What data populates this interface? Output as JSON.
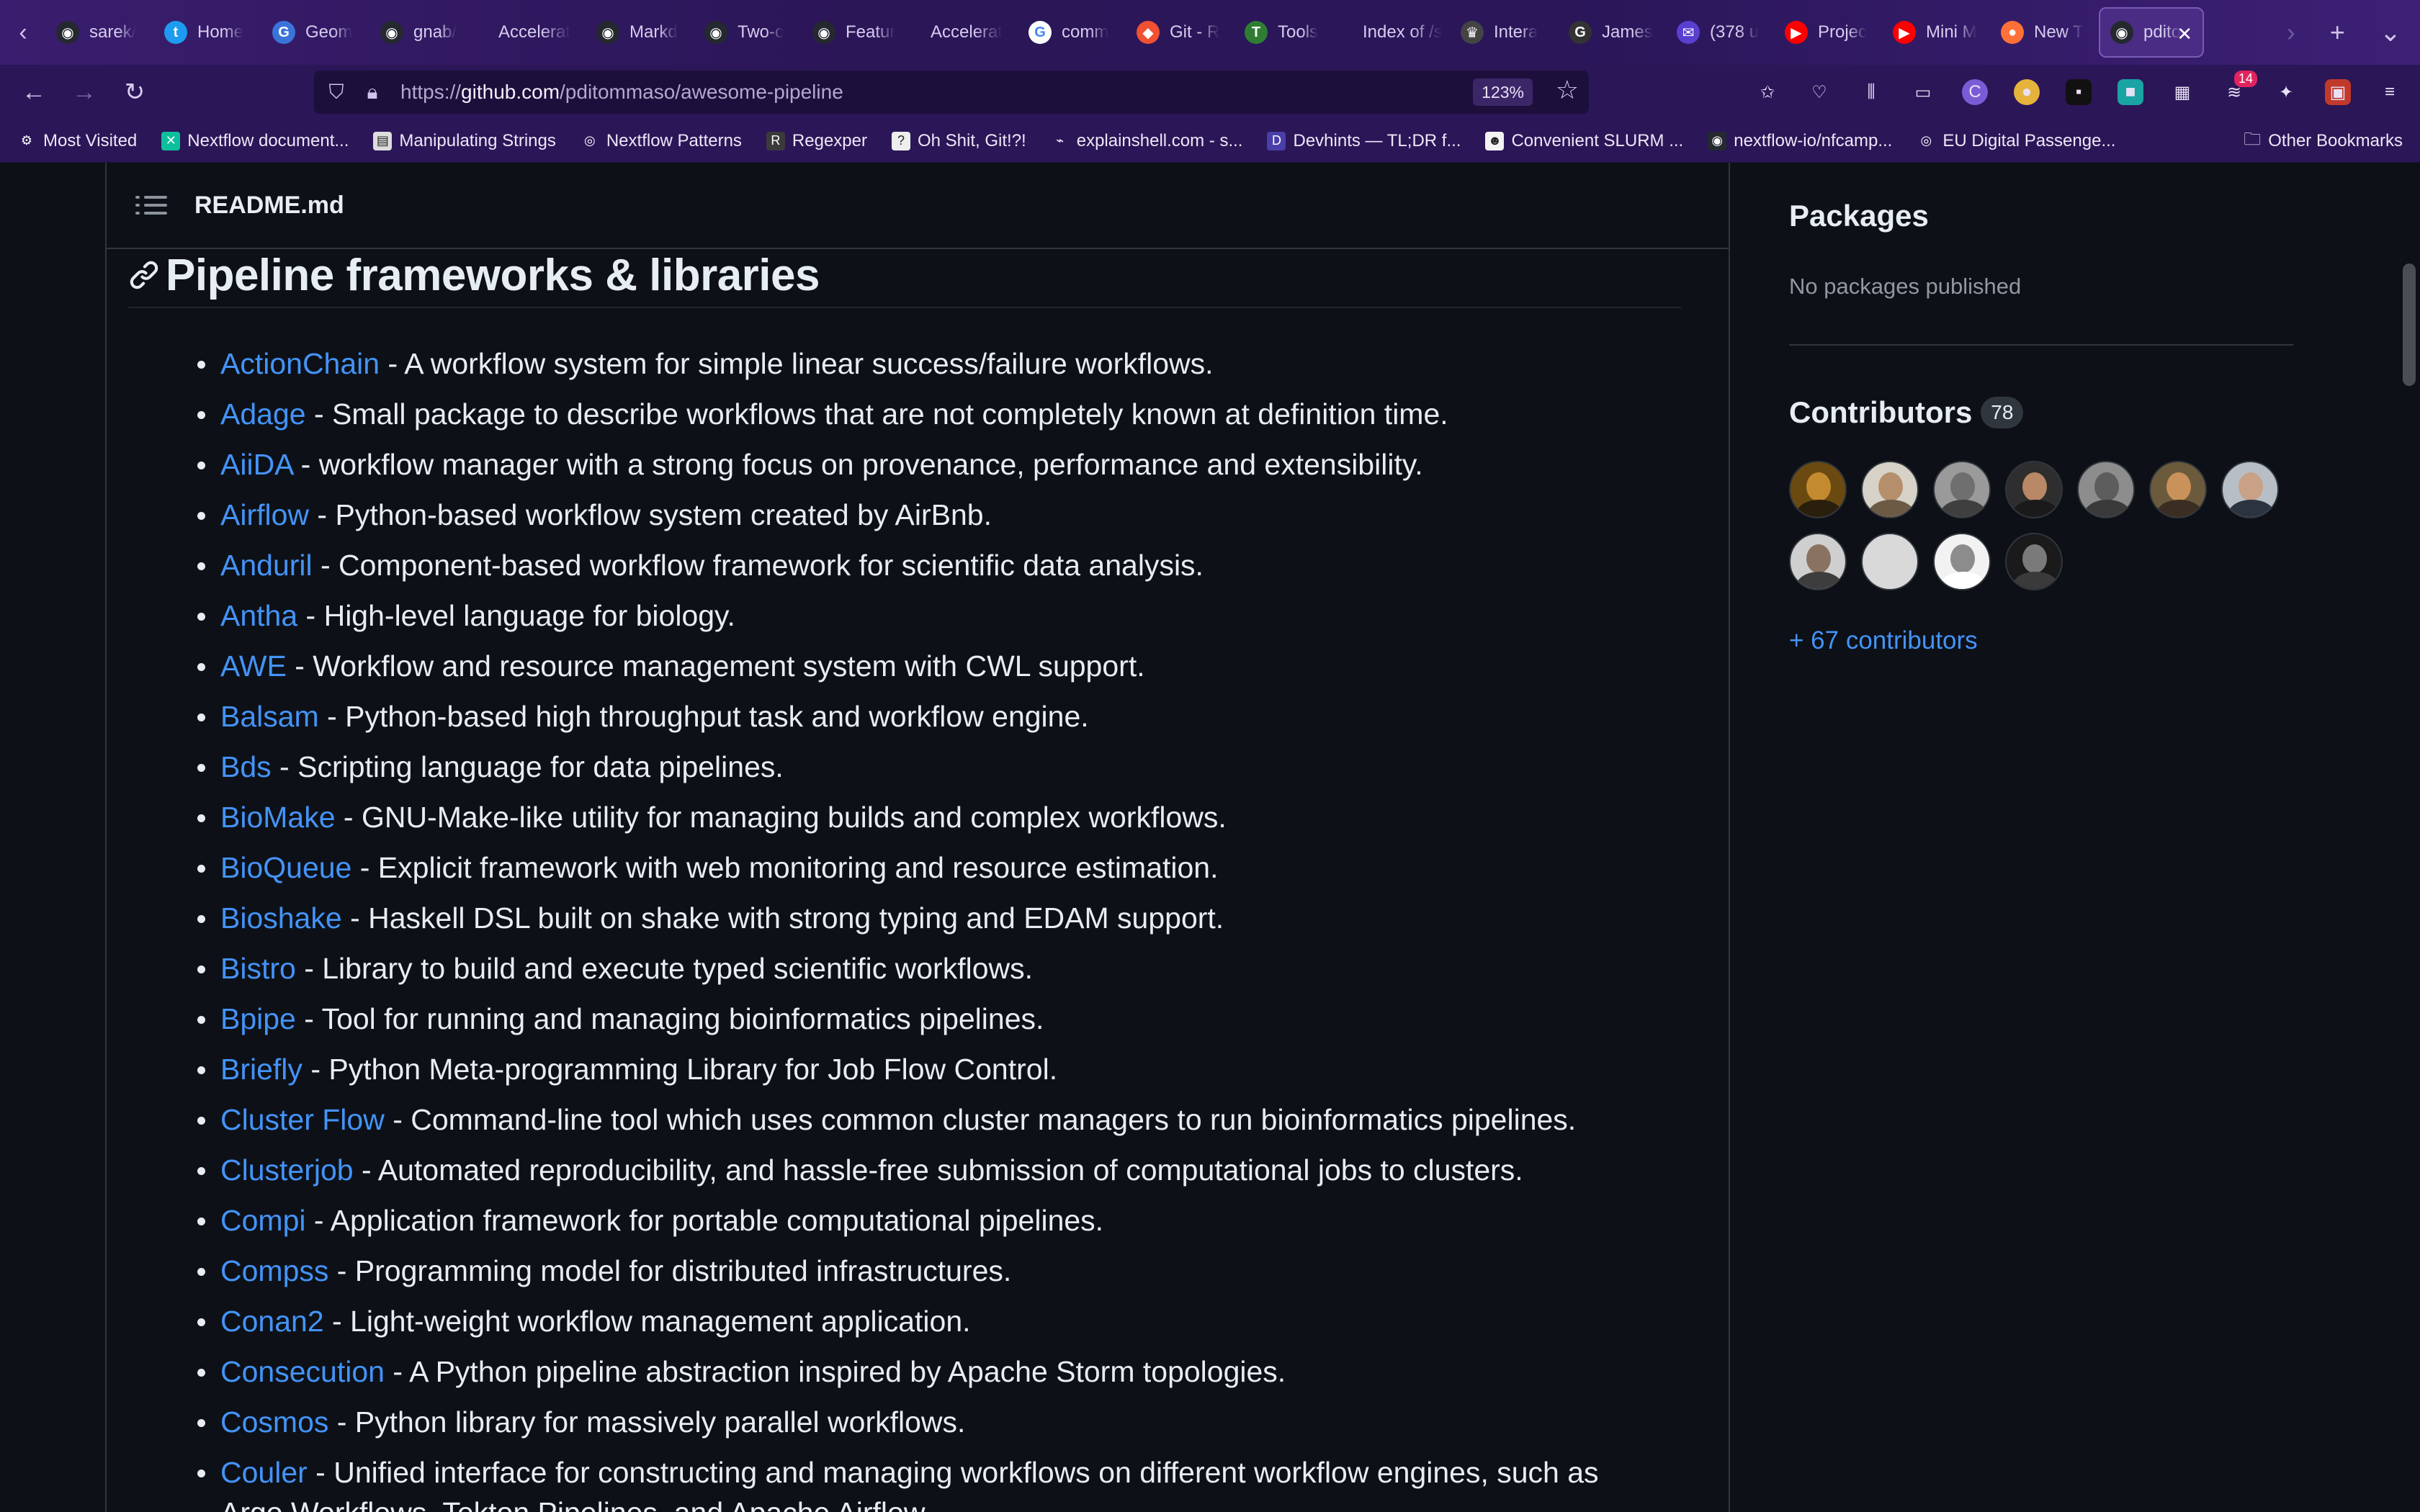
{
  "browser": {
    "tabs": [
      {
        "label": "sarek/",
        "icon": "github-icon",
        "color": "#24292f",
        "glyph": "◉"
      },
      {
        "label": "Home",
        "icon": "twitter-icon",
        "color": "#1d9bf0",
        "glyph": "t"
      },
      {
        "label": "Geom",
        "icon": "document-icon",
        "color": "#3b74d9",
        "glyph": "G"
      },
      {
        "label": "gnab/",
        "icon": "github-icon",
        "color": "#24292f",
        "glyph": "◉"
      },
      {
        "label": "Accelerat",
        "icon": "blank-page-icon",
        "color": "transparent",
        "glyph": ""
      },
      {
        "label": "Markd",
        "icon": "github-icon",
        "color": "#24292f",
        "glyph": "◉"
      },
      {
        "label": "Two-c",
        "icon": "github-icon",
        "color": "#24292f",
        "glyph": "◉"
      },
      {
        "label": "Featur",
        "icon": "github-icon",
        "color": "#24292f",
        "glyph": "◉"
      },
      {
        "label": "Accelerat",
        "icon": "blank-page-icon",
        "color": "transparent",
        "glyph": ""
      },
      {
        "label": "comm",
        "icon": "google-icon",
        "color": "#ffffff",
        "glyph": "G"
      },
      {
        "label": "Git - R",
        "icon": "git-icon",
        "color": "#f05133",
        "glyph": "◆"
      },
      {
        "label": "Tools",
        "icon": "tool-icon",
        "color": "#2e7d32",
        "glyph": "T"
      },
      {
        "label": "Index of /s",
        "icon": "blank-page-icon",
        "color": "transparent",
        "glyph": ""
      },
      {
        "label": "Intera",
        "icon": "crown-icon",
        "color": "#444",
        "glyph": "♛"
      },
      {
        "label": "James",
        "icon": "g-letter-icon",
        "color": "#333",
        "glyph": "G"
      },
      {
        "label": "(378 u",
        "icon": "mail-icon",
        "color": "#5b3fd1",
        "glyph": "✉"
      },
      {
        "label": "Projec",
        "icon": "youtube-icon",
        "color": "#ff0000",
        "glyph": "▶"
      },
      {
        "label": "Mini M",
        "icon": "youtube-icon",
        "color": "#ff0000",
        "glyph": "▶"
      },
      {
        "label": "New T",
        "icon": "firefox-icon",
        "color": "#ff7139",
        "glyph": "●"
      },
      {
        "label": "pdito",
        "icon": "github-icon",
        "color": "#24292f",
        "glyph": "◉",
        "active": true
      }
    ],
    "url_prefix": "https://",
    "url_host": "github.com",
    "url_path": "/pditommaso/awesome-pipeline",
    "zoom": "123%",
    "ext_badge": "14",
    "bookmarks": [
      {
        "label": "Most Visited",
        "icon": "gear-icon",
        "glyph": "⚙",
        "color": "transparent"
      },
      {
        "label": "Nextflow document...",
        "icon": "nextflow-icon",
        "glyph": "✕",
        "color": "#0dc09d"
      },
      {
        "label": "Manipulating Strings",
        "icon": "page-icon",
        "glyph": "▤",
        "color": "#dddddd"
      },
      {
        "label": "Nextflow Patterns",
        "icon": "globe-icon",
        "glyph": "◎",
        "color": "transparent"
      },
      {
        "label": "Regexper",
        "icon": "regexper-icon",
        "glyph": "R",
        "color": "#3a3a3a"
      },
      {
        "label": "Oh Shit, Git!?!",
        "icon": "ohshitgit-icon",
        "glyph": "?",
        "color": "#eeeeee"
      },
      {
        "label": "explainshell.com - s...",
        "icon": "shell-icon",
        "glyph": "⌁",
        "color": "transparent"
      },
      {
        "label": "Devhints — TL;DR f...",
        "icon": "devhints-icon",
        "glyph": "D",
        "color": "#4a3fa8"
      },
      {
        "label": "Convenient SLURM ...",
        "icon": "slurm-icon",
        "glyph": "☻",
        "color": "#f3f3f3"
      },
      {
        "label": "nextflow-io/nfcamp...",
        "icon": "github-icon",
        "glyph": "◉",
        "color": "#24292f"
      },
      {
        "label": "EU Digital Passenge...",
        "icon": "globe-icon",
        "glyph": "◎",
        "color": "transparent"
      }
    ],
    "other_bookmarks": "Other Bookmarks"
  },
  "readme": {
    "title": "README.md",
    "section_heading": "Pipeline frameworks & libraries",
    "items": [
      {
        "name": "ActionChain",
        "desc": " - A workflow system for simple linear success/failure workflows."
      },
      {
        "name": "Adage",
        "desc": " - Small package to describe workflows that are not completely known at definition time."
      },
      {
        "name": "AiiDA",
        "desc": " - workflow manager with a strong focus on provenance, performance and extensibility."
      },
      {
        "name": "Airflow",
        "desc": " - Python-based workflow system created by AirBnb."
      },
      {
        "name": "Anduril",
        "desc": " - Component-based workflow framework for scientific data analysis."
      },
      {
        "name": "Antha",
        "desc": " - High-level language for biology."
      },
      {
        "name": "AWE",
        "desc": " - Workflow and resource management system with CWL support."
      },
      {
        "name": "Balsam",
        "desc": " - Python-based high throughput task and workflow engine."
      },
      {
        "name": "Bds",
        "desc": " - Scripting language for data pipelines."
      },
      {
        "name": "BioMake",
        "desc": " - GNU-Make-like utility for managing builds and complex workflows."
      },
      {
        "name": "BioQueue",
        "desc": " - Explicit framework with web monitoring and resource estimation."
      },
      {
        "name": "Bioshake",
        "desc": " - Haskell DSL built on shake with strong typing and EDAM support."
      },
      {
        "name": "Bistro",
        "desc": " - Library to build and execute typed scientific workflows."
      },
      {
        "name": "Bpipe",
        "desc": " - Tool for running and managing bioinformatics pipelines."
      },
      {
        "name": "Briefly",
        "desc": " - Python Meta-programming Library for Job Flow Control."
      },
      {
        "name": "Cluster Flow",
        "desc": " - Command-line tool which uses common cluster managers to run bioinformatics pipelines."
      },
      {
        "name": "Clusterjob",
        "desc": " - Automated reproducibility, and hassle-free submission of computational jobs to clusters."
      },
      {
        "name": "Compi",
        "desc": " - Application framework for portable computational pipelines."
      },
      {
        "name": "Compss",
        "desc": " - Programming model for distributed infrastructures."
      },
      {
        "name": "Conan2",
        "desc": " - Light-weight workflow management application."
      },
      {
        "name": "Consecution",
        "desc": " - A Python pipeline abstraction inspired by Apache Storm topologies."
      },
      {
        "name": "Cosmos",
        "desc": " - Python library for massively parallel workflows."
      },
      {
        "name": "Couler",
        "desc": " - Unified interface for constructing and managing workflows on different workflow engines, such as"
      }
    ],
    "continuation": "Argo Workflows, Tekton Pipelines, and Apache Airflow."
  },
  "sidebar": {
    "packages_title": "Packages",
    "packages_empty": "No packages published",
    "contributors_title": "Contributors",
    "contributors_count": "78",
    "more_contributors": "+ 67 contributors",
    "avatars": [
      {
        "bg": "#6b4a12",
        "skin": "#c48a2f",
        "body": "#2a1e0c"
      },
      {
        "bg": "#d7d2c7",
        "skin": "#b58f6c",
        "body": "#6d5a45"
      },
      {
        "bg": "#9a9a9a",
        "skin": "#6f6f6f",
        "body": "#3f3f3f"
      },
      {
        "bg": "#2e2e2e",
        "skin": "#b98866",
        "body": "#1a1a1a"
      },
      {
        "bg": "#8d8d8d",
        "skin": "#5d5d5d",
        "body": "#3a3a3a"
      },
      {
        "bg": "#6c5a3c",
        "skin": "#c8925a",
        "body": "#3a2d22"
      },
      {
        "bg": "#b8bec6",
        "skin": "#c9a187",
        "body": "#2c3340"
      },
      {
        "bg": "#cfcfcf",
        "skin": "#8a7261",
        "body": "#3d3d3d"
      },
      {
        "bg": "#d9d9d9",
        "skin": "#d9d9d9",
        "body": "#d9d9d9"
      },
      {
        "bg": "#f2f2f2",
        "skin": "#8c8c8c",
        "body": "#ffffff"
      },
      {
        "bg": "#1a1a1a",
        "skin": "#7a7a7a",
        "body": "#3a3a3a"
      }
    ]
  }
}
